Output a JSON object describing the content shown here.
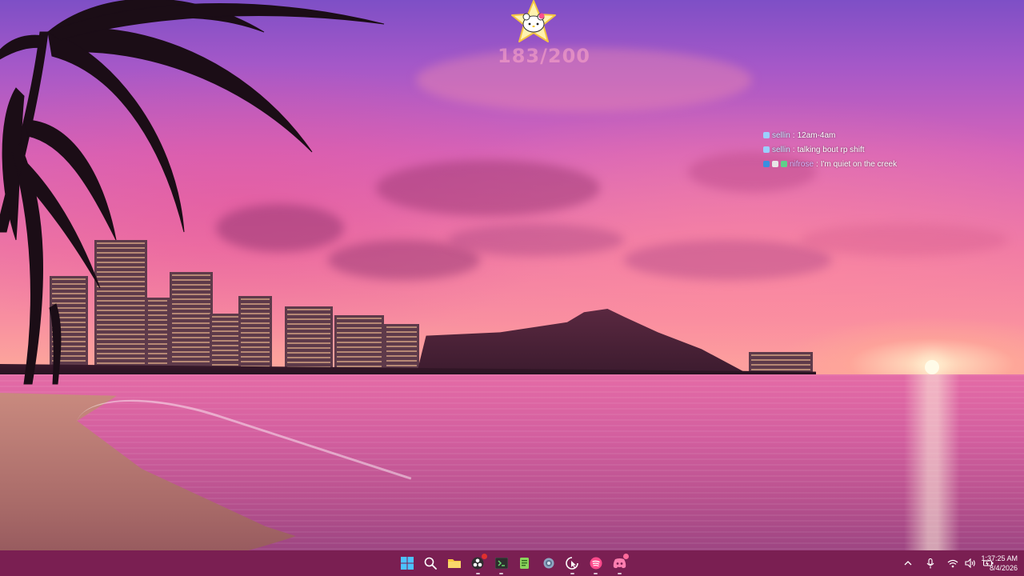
{
  "widgets": {
    "counter_text": "183/200",
    "chat": [
      {
        "user": "sellin",
        "sep": ":",
        "message": "12am-4am"
      },
      {
        "user": "sellin",
        "sep": ":",
        "message": "talking bout rp shift"
      },
      {
        "user": "nifrose",
        "sep": ":",
        "message": "I'm quiet on the creek"
      }
    ]
  },
  "taskbar": {
    "apps": [
      {
        "icon": "windows-start-icon",
        "running": false
      },
      {
        "icon": "search-icon",
        "running": false
      },
      {
        "icon": "file-explorer-icon",
        "running": false
      },
      {
        "icon": "obs-icon",
        "running": true,
        "badge": true
      },
      {
        "icon": "terminal-icon",
        "running": true
      },
      {
        "icon": "notepad-icon",
        "running": false
      },
      {
        "icon": "settings-gear-icon",
        "running": false
      },
      {
        "icon": "cursor-app-icon",
        "running": true
      },
      {
        "icon": "spotify-icon",
        "running": true
      },
      {
        "icon": "discord-icon",
        "running": true,
        "badge": true
      }
    ],
    "tray": [
      "chevron-up-icon",
      "microphone-icon",
      "wifi-icon",
      "speaker-icon",
      "battery-icon"
    ],
    "clock": {
      "time": "1:37:25 AM",
      "date": "8/4/2026"
    }
  },
  "colors": {
    "taskbar": "#7a1f52",
    "accent_pink": "#f28fb0",
    "counter": "#ffaac8"
  }
}
